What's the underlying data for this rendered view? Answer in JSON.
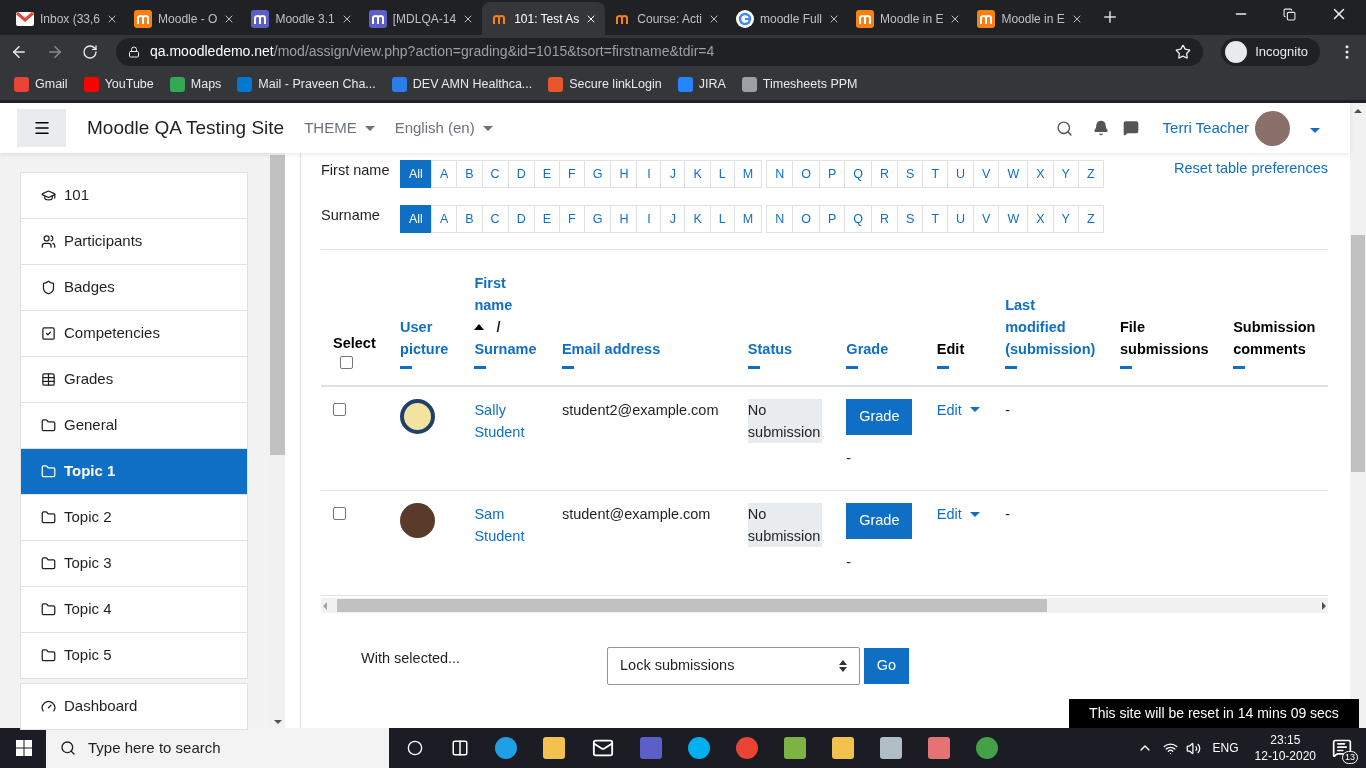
{
  "browser": {
    "tabs": [
      {
        "title": "Inbox (33,6",
        "selected": false
      },
      {
        "title": "Moodle - O",
        "selected": false
      },
      {
        "title": "Moodle 3.1",
        "selected": false
      },
      {
        "title": "[MDLQA-14",
        "selected": false
      },
      {
        "title": "101: Test As",
        "selected": true
      },
      {
        "title": "Course: Acti",
        "selected": false
      },
      {
        "title": "moodle Full",
        "selected": false
      },
      {
        "title": "Moodle in E",
        "selected": false
      },
      {
        "title": "Moodle in E",
        "selected": false
      }
    ],
    "url": {
      "host": "qa.moodledemo.net",
      "path": "/mod/assign/view.php?action=grading&id=1015&tsort=firstname&tdir=4"
    },
    "profile": "Incognito",
    "bookmarks": [
      {
        "label": "Gmail"
      },
      {
        "label": "YouTube"
      },
      {
        "label": "Maps"
      },
      {
        "label": "Mail - Praveen Cha..."
      },
      {
        "label": "DEV AMN Healthca..."
      },
      {
        "label": "Secure linkLogin"
      },
      {
        "label": "JIRA"
      },
      {
        "label": "Timesheets PPM"
      }
    ]
  },
  "header": {
    "site_name": "Moodle QA Testing Site",
    "menus": [
      {
        "label": "THEME"
      },
      {
        "label": "English (en)"
      }
    ],
    "user": "Terri Teacher"
  },
  "sidebar": {
    "items": [
      {
        "label": "101",
        "selected": false
      },
      {
        "label": "Participants",
        "selected": false
      },
      {
        "label": "Badges",
        "selected": false
      },
      {
        "label": "Competencies",
        "selected": false
      },
      {
        "label": "Grades",
        "selected": false
      },
      {
        "label": "General",
        "selected": false
      },
      {
        "label": "Topic 1",
        "selected": true
      },
      {
        "label": "Topic 2",
        "selected": false
      },
      {
        "label": "Topic 3",
        "selected": false
      },
      {
        "label": "Topic 4",
        "selected": false
      },
      {
        "label": "Topic 5",
        "selected": false
      },
      {
        "label": "Dashboard",
        "selected": false
      }
    ]
  },
  "reset_link": "Reset table preferences",
  "initials": [
    {
      "label": "First name",
      "letters": [
        {
          "letter": "All",
          "selected": true
        },
        {
          "letter": "A",
          "selected": false
        },
        {
          "letter": "B",
          "selected": false
        },
        {
          "letter": "C",
          "selected": false
        },
        {
          "letter": "D",
          "selected": false
        },
        {
          "letter": "E",
          "selected": false
        },
        {
          "letter": "F",
          "selected": false
        },
        {
          "letter": "G",
          "selected": false
        },
        {
          "letter": "H",
          "selected": false
        },
        {
          "letter": "I",
          "selected": false
        },
        {
          "letter": "J",
          "selected": false
        },
        {
          "letter": "K",
          "selected": false
        },
        {
          "letter": "L",
          "selected": false
        },
        {
          "letter": "M",
          "selected": false
        },
        {
          "letter": "N",
          "selected": false
        },
        {
          "letter": "O",
          "selected": false
        },
        {
          "letter": "P",
          "selected": false
        },
        {
          "letter": "Q",
          "selected": false
        },
        {
          "letter": "R",
          "selected": false
        },
        {
          "letter": "S",
          "selected": false
        },
        {
          "letter": "T",
          "selected": false
        },
        {
          "letter": "U",
          "selected": false
        },
        {
          "letter": "V",
          "selected": false
        },
        {
          "letter": "W",
          "selected": false
        },
        {
          "letter": "X",
          "selected": false
        },
        {
          "letter": "Y",
          "selected": false
        },
        {
          "letter": "Z",
          "selected": false
        }
      ]
    },
    {
      "label": "Surname",
      "letters": [
        {
          "letter": "All",
          "selected": true
        },
        {
          "letter": "A",
          "selected": false
        },
        {
          "letter": "B",
          "selected": false
        },
        {
          "letter": "C",
          "selected": false
        },
        {
          "letter": "D",
          "selected": false
        },
        {
          "letter": "E",
          "selected": false
        },
        {
          "letter": "F",
          "selected": false
        },
        {
          "letter": "G",
          "selected": false
        },
        {
          "letter": "H",
          "selected": false
        },
        {
          "letter": "I",
          "selected": false
        },
        {
          "letter": "J",
          "selected": false
        },
        {
          "letter": "K",
          "selected": false
        },
        {
          "letter": "L",
          "selected": false
        },
        {
          "letter": "M",
          "selected": false
        },
        {
          "letter": "N",
          "selected": false
        },
        {
          "letter": "O",
          "selected": false
        },
        {
          "letter": "P",
          "selected": false
        },
        {
          "letter": "Q",
          "selected": false
        },
        {
          "letter": "R",
          "selected": false
        },
        {
          "letter": "S",
          "selected": false
        },
        {
          "letter": "T",
          "selected": false
        },
        {
          "letter": "U",
          "selected": false
        },
        {
          "letter": "V",
          "selected": false
        },
        {
          "letter": "W",
          "selected": false
        },
        {
          "letter": "X",
          "selected": false
        },
        {
          "letter": "Y",
          "selected": false
        },
        {
          "letter": "Z",
          "selected": false
        }
      ]
    }
  ],
  "table": {
    "columns": [
      {
        "kind": "select",
        "label": "Select",
        "checked": false
      },
      {
        "kind": "link",
        "label": "User picture"
      },
      {
        "kind": "name_sort",
        "first": "First name",
        "separator": "/",
        "last": "Surname"
      },
      {
        "kind": "link",
        "label": "Email address"
      },
      {
        "kind": "link",
        "label": "Status"
      },
      {
        "kind": "link",
        "label": "Grade"
      },
      {
        "kind": "plain",
        "label": "Edit"
      },
      {
        "kind": "link",
        "label": "Last modified (submission)"
      },
      {
        "kind": "plain",
        "label": "File submissions"
      },
      {
        "kind": "plain",
        "label": "Submission comments"
      }
    ],
    "rows": [
      {
        "checked": false,
        "name": "Sally Student",
        "email": "student2@example.com",
        "status": "No submission",
        "grade_button": "Grade",
        "grade": "-",
        "edit": "Edit",
        "last_modified": "-"
      },
      {
        "checked": false,
        "name": "Sam Student",
        "email": "student@example.com",
        "status": "No submission",
        "grade_button": "Grade",
        "grade": "-",
        "edit": "Edit",
        "last_modified": "-"
      }
    ]
  },
  "bulk": {
    "label": "With selected...",
    "select": "Lock submissions",
    "button": "Go"
  },
  "notice": "This site will be reset in 14 mins 09 secs",
  "taskbar": {
    "search_placeholder": "Type here to search",
    "language": "ENG",
    "time": "23:15",
    "date": "12-10-2020",
    "notifications": "13"
  }
}
